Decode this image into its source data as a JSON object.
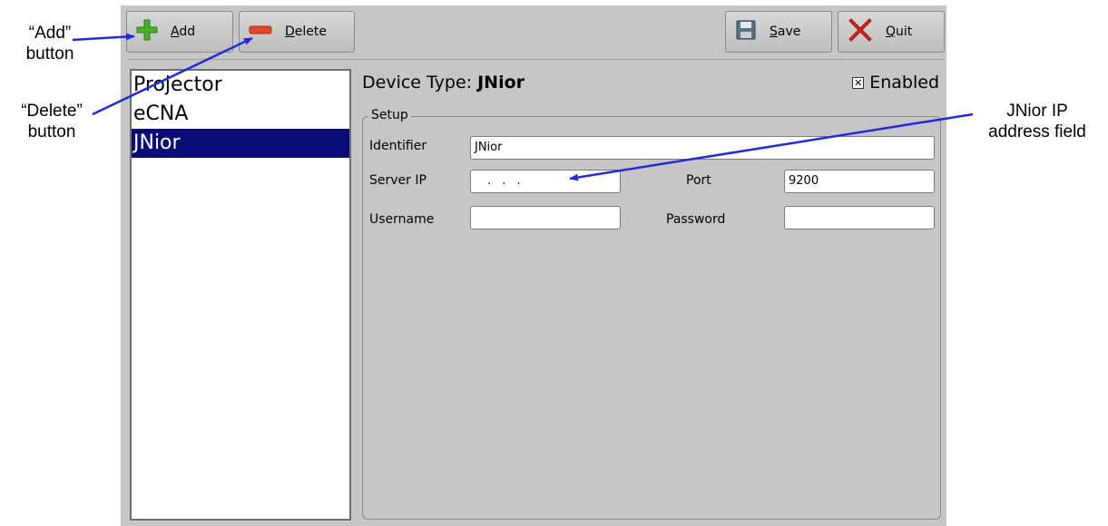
{
  "callouts": {
    "add": [
      "“Add”",
      "button"
    ],
    "delete": [
      "“Delete”",
      "button"
    ],
    "ip": [
      "JNior IP",
      "address field"
    ]
  },
  "toolbar": {
    "add_label": "Add",
    "delete_label": "Delete",
    "save_label": "Save",
    "quit_label": "Quit",
    "icons": {
      "add": "plus-icon",
      "delete": "minus-icon",
      "save": "floppy-disk-icon",
      "quit": "red-x-icon"
    }
  },
  "devices": [
    "Projector",
    "eCNA",
    "JNior"
  ],
  "selected_device": "JNior",
  "details": {
    "device_type_label": "Device Type:",
    "device_type_value": "JNior",
    "enabled_label": "Enabled",
    "enabled": true,
    "group_title": "Setup",
    "identifier_label": "Identifier",
    "identifier_value": "JNior",
    "server_ip_label": "Server IP",
    "server_ip_value": ". . .",
    "port_label": "Port",
    "port_value": "9200",
    "username_label": "Username",
    "username_value": "",
    "password_label": "Password",
    "password_value": ""
  },
  "colors": {
    "window_bg": "#c6c6c6",
    "selection_bg": "#0a0a78",
    "callout_arrow": "#1f2bdc",
    "add_icon": "#4caf2a",
    "delete_icon": "#e04a2a",
    "quit_icon": "#e02020"
  }
}
